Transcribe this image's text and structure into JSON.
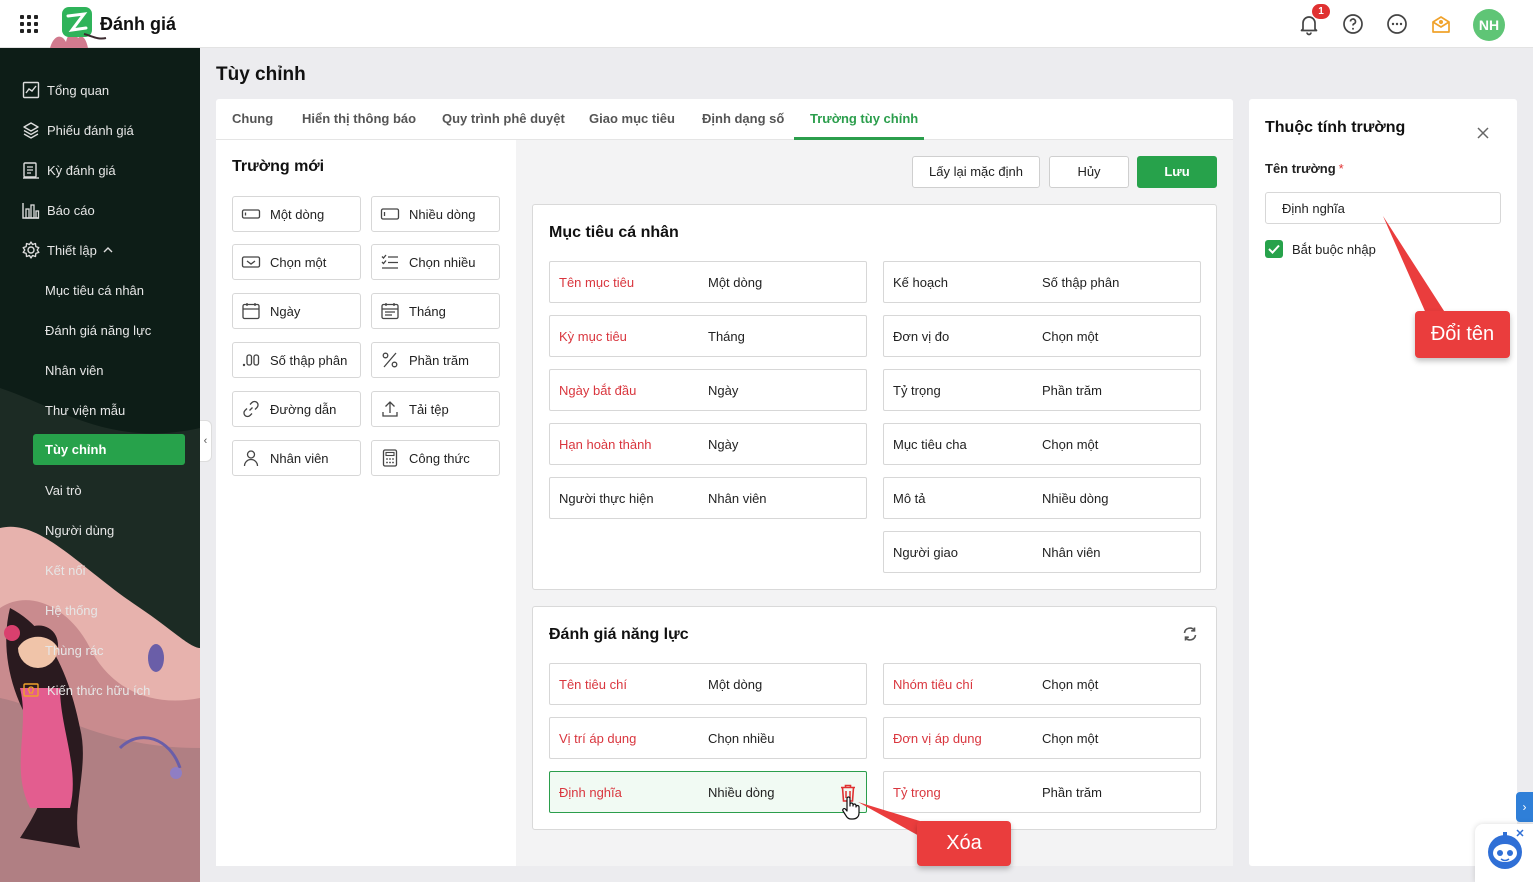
{
  "app": {
    "title": "Đánh giá",
    "notification_count": "1",
    "avatar_initials": "NH"
  },
  "topbar_icons": [
    "apps-grid-icon",
    "bell-icon",
    "help-icon",
    "more-icon",
    "gift-icon"
  ],
  "sidebar": {
    "items": [
      {
        "label": "Tổng quan",
        "icon": "dashboard-icon"
      },
      {
        "label": "Phiếu đánh giá",
        "icon": "layers-icon"
      },
      {
        "label": "Kỳ đánh giá",
        "icon": "calendar-list-icon"
      },
      {
        "label": "Báo cáo",
        "icon": "chart-icon"
      },
      {
        "label": "Thiết lập",
        "icon": "settings-icon"
      }
    ],
    "sub_items": [
      {
        "label": "Mục tiêu cá nhân"
      },
      {
        "label": "Đánh giá năng lực"
      },
      {
        "label": "Nhân viên"
      },
      {
        "label": "Thư viện mẫu"
      },
      {
        "label": "Tùy chỉnh",
        "active": true
      },
      {
        "label": "Vai trò"
      },
      {
        "label": "Người dùng"
      },
      {
        "label": "Kết nối"
      },
      {
        "label": "Hệ thống"
      },
      {
        "label": "Thùng rác"
      }
    ],
    "footer_item": {
      "label": "Kiến thức hữu ích",
      "icon": "lightbulb-icon"
    }
  },
  "page": {
    "title": "Tùy chỉnh"
  },
  "tabs": [
    {
      "label": "Chung"
    },
    {
      "label": "Hiển thị thông báo"
    },
    {
      "label": "Quy trình phê duyệt"
    },
    {
      "label": "Giao mục tiêu"
    },
    {
      "label": "Định dạng số"
    },
    {
      "label": "Trường tùy chỉnh",
      "active": true
    }
  ],
  "new_field_panel": {
    "title": "Trường mới",
    "types": [
      {
        "label": "Một dòng",
        "icon": "single-line-icon"
      },
      {
        "label": "Nhiều dòng",
        "icon": "multi-line-icon"
      },
      {
        "label": "Chọn một",
        "icon": "dropdown-icon"
      },
      {
        "label": "Chọn nhiều",
        "icon": "checklist-icon"
      },
      {
        "label": "Ngày",
        "icon": "calendar-icon"
      },
      {
        "label": "Tháng",
        "icon": "month-calendar-icon"
      },
      {
        "label": "Số thập phân",
        "icon": "decimal-icon"
      },
      {
        "label": "Phần trăm",
        "icon": "percent-icon"
      },
      {
        "label": "Đường dẫn",
        "icon": "link-icon"
      },
      {
        "label": "Tải tệp",
        "icon": "upload-icon"
      },
      {
        "label": "Nhân viên",
        "icon": "user-icon"
      },
      {
        "label": "Công thức",
        "icon": "calculator-icon"
      }
    ]
  },
  "actions": {
    "reset": "Lấy lại mặc định",
    "cancel": "Hủy",
    "save": "Lưu"
  },
  "groups": [
    {
      "title": "Mục tiêu cá nhân",
      "left": [
        {
          "name": "Tên mục tiêu",
          "type": "Một dòng",
          "required": true
        },
        {
          "name": "Kỳ mục tiêu",
          "type": "Tháng",
          "required": true
        },
        {
          "name": "Ngày bắt đầu",
          "type": "Ngày",
          "required": true
        },
        {
          "name": "Hạn hoàn thành",
          "type": "Ngày",
          "required": true
        },
        {
          "name": "Người thực hiện",
          "type": "Nhân viên",
          "required": false
        }
      ],
      "right": [
        {
          "name": "Kế hoạch",
          "type": "Số thập phân",
          "required": false
        },
        {
          "name": "Đơn vị đo",
          "type": "Chọn một",
          "required": false
        },
        {
          "name": "Tỷ trọng",
          "type": "Phần trăm",
          "required": false
        },
        {
          "name": "Mục tiêu cha",
          "type": "Chọn một",
          "required": false
        },
        {
          "name": "Mô tả",
          "type": "Nhiều dòng",
          "required": false
        },
        {
          "name": "Người giao",
          "type": "Nhân viên",
          "required": false
        }
      ]
    },
    {
      "title": "Đánh giá năng lực",
      "left": [
        {
          "name": "Tên tiêu chí",
          "type": "Một dòng",
          "required": true
        },
        {
          "name": "Vị trí áp dụng",
          "type": "Chọn nhiều",
          "required": true
        },
        {
          "name": "Định nghĩa",
          "type": "Nhiều dòng",
          "required": true,
          "selected": true
        }
      ],
      "right": [
        {
          "name": "Nhóm tiêu chí",
          "type": "Chọn một",
          "required": true
        },
        {
          "name": "Đơn vị áp dụng",
          "type": "Chọn một",
          "required": true
        },
        {
          "name": "Tỷ trọng",
          "type": "Phần trăm",
          "required": true
        }
      ]
    }
  ],
  "properties": {
    "title": "Thuộc tính trường",
    "field_name_label": "Tên trường",
    "required_mark": "*",
    "field_name_value": "Định nghĩa",
    "required_checkbox": {
      "label": "Bắt buộc nhập",
      "checked": true
    }
  },
  "callouts": {
    "rename": "Đổi tên",
    "delete": "Xóa"
  },
  "colors": {
    "accent": "#27a24b",
    "required_text": "#d9363e",
    "callout": "#ea3d3d",
    "sidebar_bg": "#0d1d17"
  }
}
